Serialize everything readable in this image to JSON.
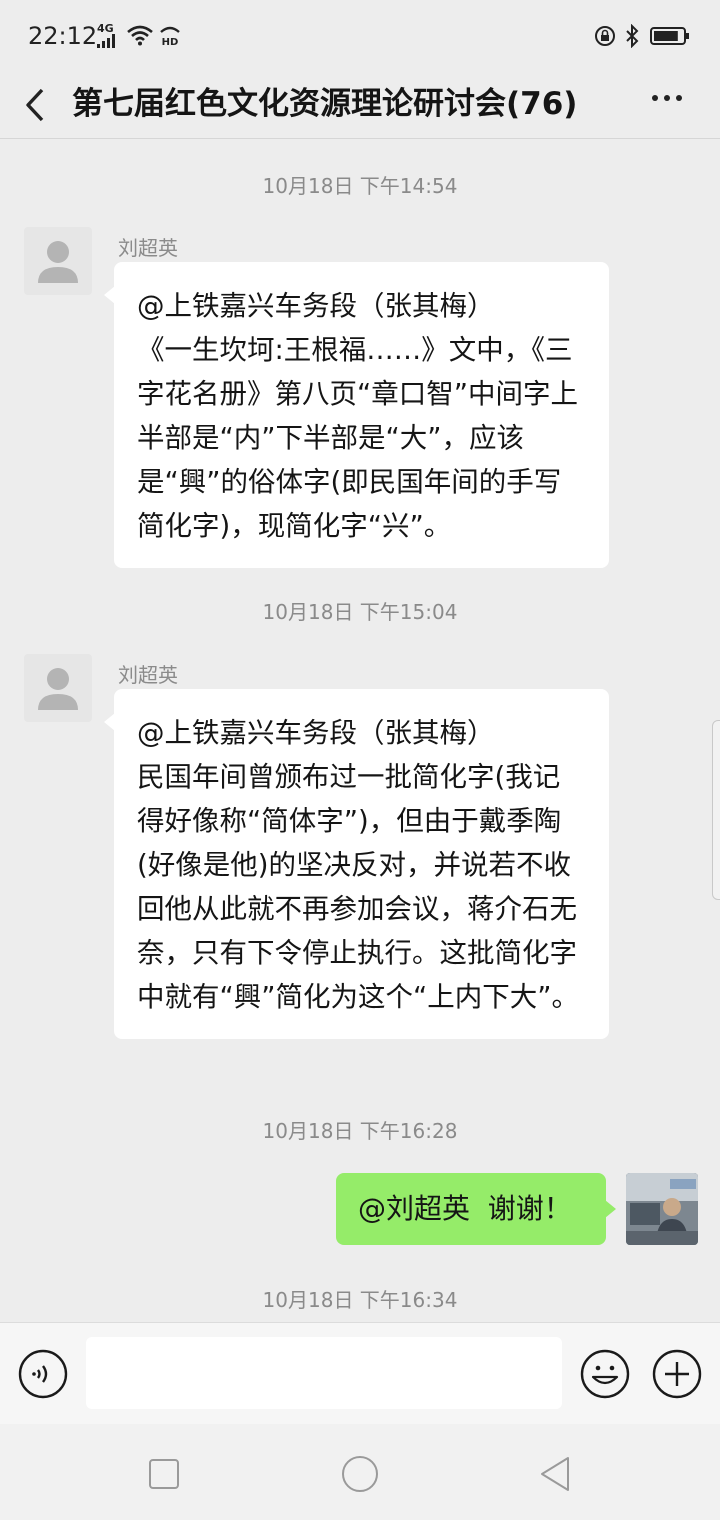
{
  "status_bar": {
    "time": "22:12",
    "network": "4G",
    "hd_label": "HD",
    "battery_level_percent": 85
  },
  "header": {
    "title": "第七届红色文化资源理论研讨会(76)",
    "back_icon": "chevron-left-icon",
    "more_icon": "more-horizontal-icon"
  },
  "messages": [
    {
      "kind": "timestamp",
      "text": "10月18日 下午14:54"
    },
    {
      "kind": "incoming",
      "sender": "刘超英",
      "text": "@上铁嘉兴车务段（张其梅）\n《一生坎坷:王根福……》文中，《三字花名册》第八页“章口智”中间字上半部是“内”下半部是“大”，应该是“興”的俗体字(即民国年间的手写简化字)，现简化字“兴”。"
    },
    {
      "kind": "timestamp",
      "text": "10月18日 下午15:04"
    },
    {
      "kind": "incoming",
      "sender": "刘超英",
      "text": "@上铁嘉兴车务段（张其梅）\n民国年间曾颁布过一批简化字(我记得好像称“简体字”)，但由于戴季陶(好像是他)的坚决反对，并说若不收回他从此就不再参加会议，蒋介石无奈，只有下令停止执行。这批简化字中就有“興”简化为这个“上内下大”。"
    },
    {
      "kind": "timestamp",
      "text": "10月18日 下午16:28"
    },
    {
      "kind": "outgoing",
      "text": "@刘超英  谢谢！"
    },
    {
      "kind": "timestamp",
      "text": "10月18日 下午16:34"
    }
  ],
  "input_bar": {
    "value": "",
    "voice_icon": "voice-input-icon",
    "emoji_icon": "emoji-icon",
    "plus_icon": "plus-icon"
  },
  "nav_bar": {
    "recents_icon": "square-icon",
    "home_icon": "circle-icon",
    "back_icon": "triangle-back-icon"
  },
  "colors": {
    "background": "#ededed",
    "incoming_bubble": "#ffffff",
    "outgoing_bubble": "#95ec69",
    "timestamp_text": "#8a8a8a",
    "title_text": "#151515"
  }
}
